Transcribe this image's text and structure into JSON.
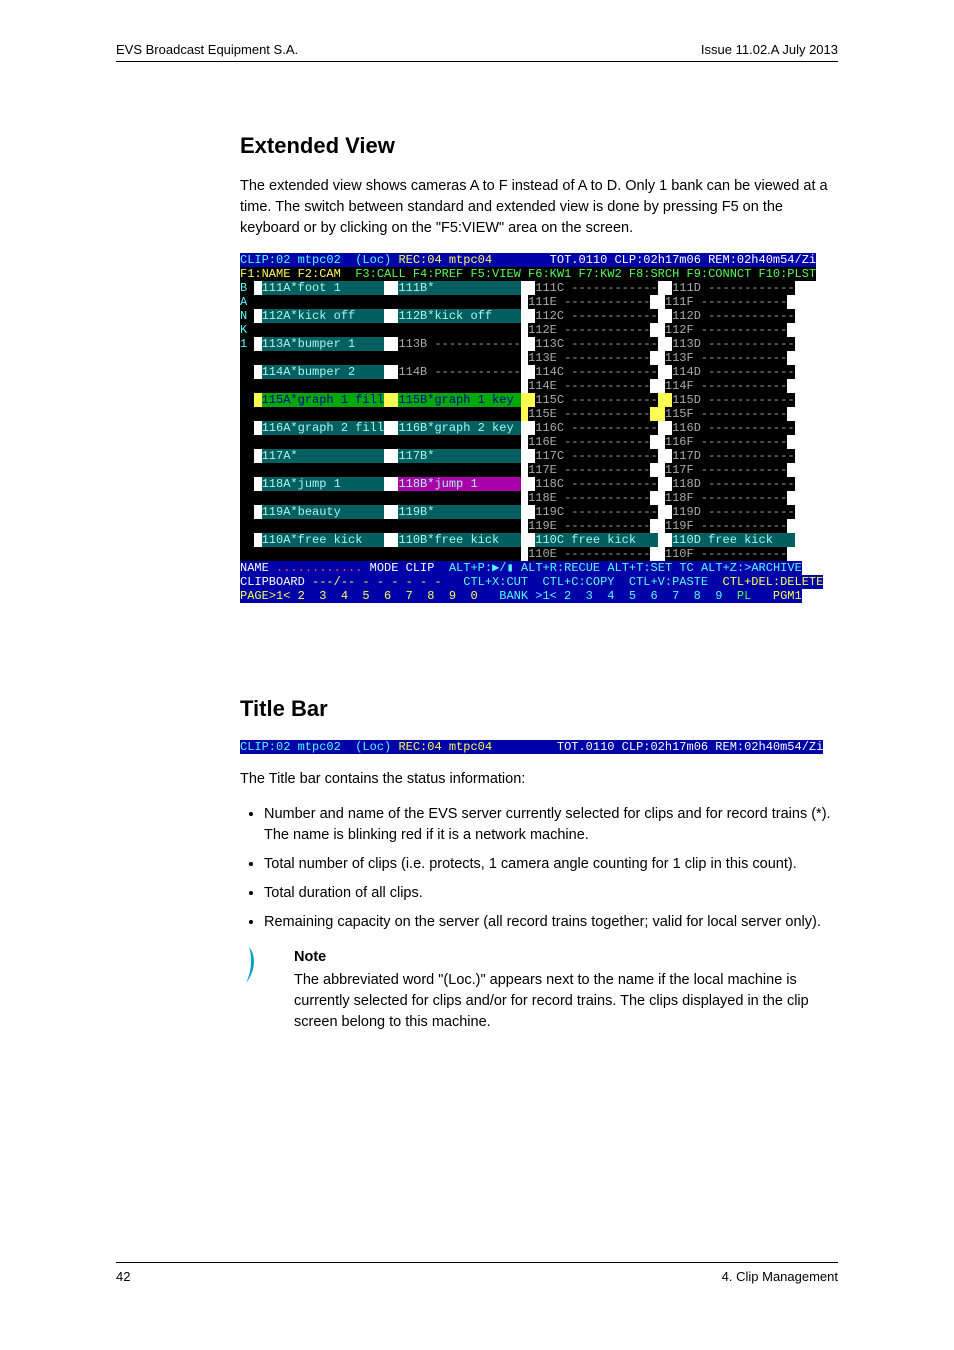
{
  "header": {
    "left": "EVS Broadcast Equipment S.A.",
    "right": "Issue 11.02.A July 2013"
  },
  "footer": {
    "left": "42",
    "right": "4. Clip Management"
  },
  "section1": {
    "heading": "Extended View",
    "paragraph": "The extended view shows cameras A to F instead of A to D. Only 1 bank can be viewed at a time. The switch between standard and extended view is done by pressing F5 on the keyboard or by clicking on the \"F5:VIEW\" area on the screen."
  },
  "term": {
    "title_line": {
      "clip": "CLIP:02 mtpc02  (Loc) ",
      "rec": "REC:04 mtpc04        ",
      "stats": "TOT.0110 CLP:02h17m06 REM:02h40m54/Zi"
    },
    "fn_line": {
      "f1f2": "F1:NAME F2:CAM ",
      "rest": " F3:CALL F4:PREF F5:VIEW F6:KW1 F7:KW2 F8:SRCH F9:CONNCT F10:PLST"
    },
    "side_label": "BANK1",
    "rows": [
      {
        "a": "111A*foot 1      ",
        "b": "111B*            ",
        "dashB": false,
        "c": "111C ------------",
        "d": "111D ------------",
        "e": "111E ------------",
        "f": "111F ------------",
        "selA": true,
        "selB": true
      },
      {
        "a": "112A*kick off    ",
        "b": "112B*kick off    ",
        "dashB": false,
        "c": "112C ------------",
        "d": "112D ------------",
        "e": "112E ------------",
        "f": "112F ------------",
        "selA": true,
        "selB": true
      },
      {
        "a": "113A*bumper 1    ",
        "b": "113B ------------",
        "dashB": true,
        "c": "113C ------------",
        "d": "113D ------------",
        "e": "113E ------------",
        "f": "113F ------------",
        "selA": true,
        "selB": false
      },
      {
        "a": "114A*bumper 2    ",
        "b": "114B ------------",
        "dashB": true,
        "c": "114C ------------",
        "d": "114D ------------",
        "e": "114E ------------",
        "f": "114F ------------",
        "selA": true,
        "selB": false
      },
      {
        "a": "115A*graph 1 fill",
        "b": "115B*graph 1 key ",
        "dashB": false,
        "c": "115C ------------",
        "d": "115D ------------",
        "e": "115E ------------",
        "f": "115F ------------",
        "hl": true
      },
      {
        "a": "116A*graph 2 fill",
        "b": "116B*graph 2 key ",
        "dashB": false,
        "c": "116C ------------",
        "d": "116D ------------",
        "e": "116E ------------",
        "f": "116F ------------",
        "selA": true,
        "selB": true
      },
      {
        "a": "117A*            ",
        "b": "117B*            ",
        "dashB": false,
        "c": "117C ------------",
        "d": "117D ------------",
        "e": "117E ------------",
        "f": "117F ------------",
        "selA": true,
        "selB": true
      },
      {
        "a": "118A*jump 1      ",
        "b": "118B*jump 1      ",
        "dashB": false,
        "c": "118C ------------",
        "d": "118D ------------",
        "e": "118E ------------",
        "f": "118F ------------",
        "selA": true,
        "selB": true,
        "selBmag": true
      },
      {
        "a": "119A*beauty      ",
        "b": "119B*            ",
        "dashB": false,
        "c": "119C ------------",
        "d": "119D ------------",
        "e": "119E ------------",
        "f": "119F ------------",
        "selA": true,
        "selB": true
      },
      {
        "a": "110A*free kick   ",
        "b": "110B*free kick   ",
        "dashB": false,
        "c": "110C free kick   ",
        "d": "110D free kick   ",
        "e": "110E ------------",
        "f": "110F ------------",
        "selA": true,
        "selB": true,
        "selC": true,
        "selD": true
      }
    ],
    "status": {
      "name_line_a": "NAME ",
      "name_line_b": "............",
      "name_line_c": " MODE CLIP  ",
      "name_line_d": "ALT+P:▶/▮ ALT+R:RECUE ALT+T:SET TC ALT+Z:>ARCHIVE",
      "clip_line_a": "CLIPBOARD ",
      "clip_line_b": "---/-- - - - - - -",
      "clip_line_c": "   CTL+X:CUT  CTL+C:COPY  CTL+V:PASTE  ",
      "clip_line_d": "CTL+DEL:DELETE",
      "page_line_a": "PAGE>1< 2  3  4  5  6  7  8  9  0",
      "page_line_b": "   BANK >1< 2  3  4  5  6  7  8  9  ",
      "page_line_c": "PL",
      "page_line_d": "   PGM1"
    }
  },
  "section2": {
    "heading": "Title Bar",
    "titlebar": {
      "clip": "CLIP:02 mtpc02  (Loc) ",
      "rec": "REC:04 mtpc04      ",
      "stats": "   TOT.0110 CLP:02h17m06 REM:02h40m54/Zi"
    },
    "lead": "The Title bar contains the status information:",
    "bullets": [
      "Number and name of the EVS server currently selected for clips and for record trains (*). The name is blinking red if it is a network machine.",
      "Total number of clips (i.e. protects, 1 camera angle counting for 1 clip in this count).",
      "Total duration of all clips.",
      "Remaining capacity on the server (all record trains together; valid for local server only)."
    ],
    "note_title": "Note",
    "note_body": "The abbreviated word \"(Loc.)\" appears next to the name if the local machine is currently selected for clips and/or for record trains. The clips displayed in the clip screen belong to this machine."
  }
}
